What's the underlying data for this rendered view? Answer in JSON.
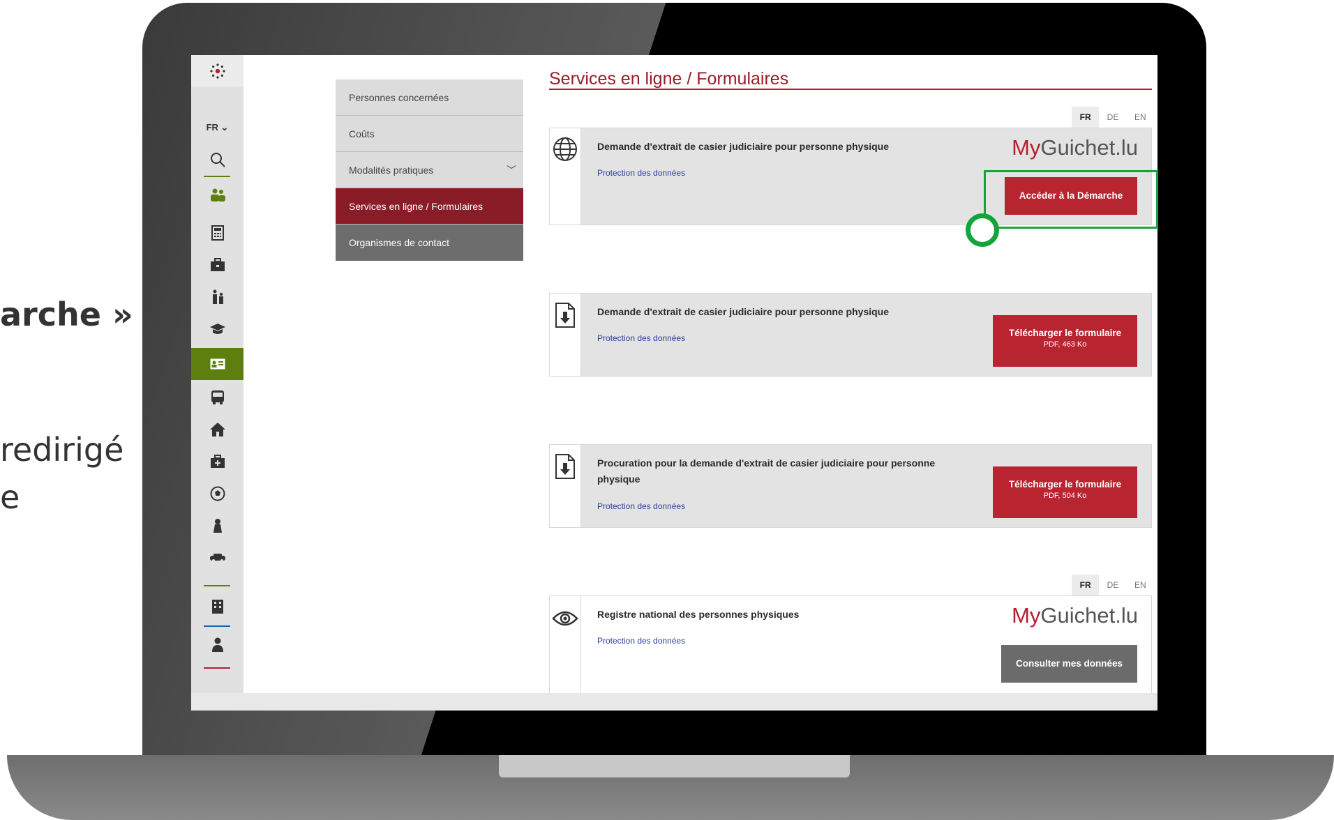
{
  "side_text": {
    "line1": "arche »",
    "line2": "redirigé",
    "line3": "e"
  },
  "rail": {
    "lang": "FR",
    "icons": [
      "logo-icon",
      "search-icon",
      "people-icon",
      "calculator-icon",
      "briefcase-icon",
      "family-icon",
      "graduation-cap-icon",
      "id-card-icon",
      "bus-icon",
      "house-icon",
      "first-aid-icon",
      "soccer-ball-icon",
      "culture-icon",
      "vehicle-icon",
      "building-icon",
      "person-icon"
    ],
    "active_color": "#5d7f0e"
  },
  "subnav": {
    "items": [
      {
        "label": "Personnes concernées"
      },
      {
        "label": "Coûts"
      },
      {
        "label": "Modalités pratiques"
      },
      {
        "label": "Services en ligne / Formulaires"
      },
      {
        "label": "Organismes de contact"
      }
    ]
  },
  "main": {
    "title": "Services en ligne / Formulaires",
    "lang_tabs": [
      "FR",
      "DE",
      "EN"
    ],
    "brand_prefix": "My",
    "brand_suffix": "Guichet.lu",
    "link_label": "Protection des données",
    "cards": [
      {
        "title": "Demande d'extrait de casier judiciaire pour personne physique",
        "button": "Accéder à la Démarche",
        "icon": "globe-icon"
      },
      {
        "title": "Demande d'extrait de casier judiciaire pour personne physique",
        "button": "Télécharger le formulaire",
        "button_sub": "PDF, 463 Ko",
        "icon": "download-icon"
      },
      {
        "title": "Procuration pour la demande d'extrait de casier judiciaire pour personne physique",
        "button": "Télécharger le formulaire",
        "button_sub": "PDF, 504 Ko",
        "icon": "download-icon"
      },
      {
        "title": "Registre national des personnes physiques",
        "button": "Consulter mes données",
        "icon": "eye-icon"
      }
    ]
  },
  "colors": {
    "accent_red": "#b82530",
    "title_red": "#9a1c26",
    "highlight_green": "#14a53a",
    "link_blue": "#2a3f9a"
  }
}
